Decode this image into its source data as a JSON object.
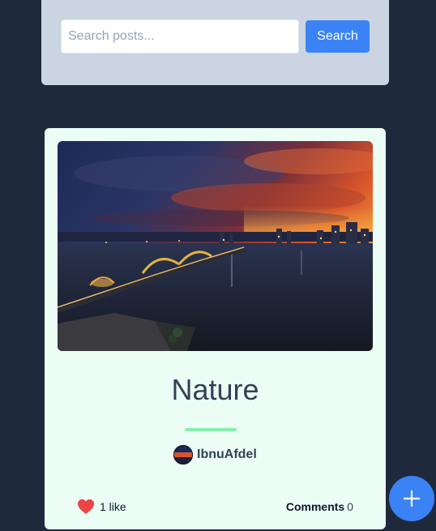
{
  "search": {
    "placeholder": "Search posts...",
    "button_label": "Search"
  },
  "post": {
    "title": "Nature",
    "image_alt": "City skyline at sunset with lit bridge over river",
    "author": "IbnuAfdel",
    "likes_label": "1 like",
    "comments_label": "Comments",
    "comments_count": "0"
  },
  "colors": {
    "background": "#1e293b",
    "accent": "#3b82f6",
    "card": "#ecfdf5",
    "divider": "#86efac",
    "heart": "#ef4444"
  },
  "icons": {
    "like": "heart-icon",
    "add": "plus-icon"
  }
}
